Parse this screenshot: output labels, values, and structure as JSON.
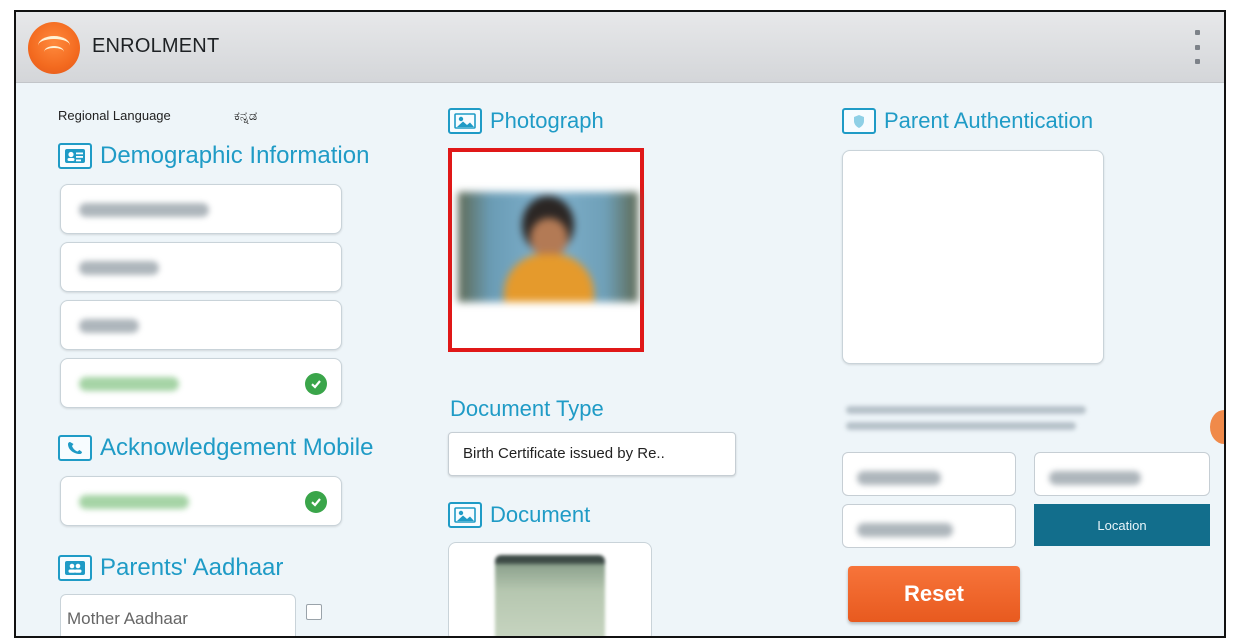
{
  "appbar": {
    "title": "ENROLMENT"
  },
  "regional": {
    "label": "Regional Language",
    "value": "ಕನ್ನಡ"
  },
  "sections": {
    "demographic": "Demographic Information",
    "acknowledgement_mobile": "Acknowledgement Mobile",
    "parents_aadhaar": "Parents' Aadhaar",
    "photograph": "Photograph",
    "document_type": "Document Type",
    "document": "Document",
    "parent_authentication": "Parent Authentication"
  },
  "document_type": {
    "selected": "Birth Certificate issued by Re.."
  },
  "parents": {
    "mother_placeholder": "Mother Aadhaar"
  },
  "buttons": {
    "location": "Location",
    "reset": "Reset"
  },
  "colors": {
    "accent": "#1f9bc6",
    "reset": "#e85a1f",
    "location": "#126e8c",
    "highlight_border": "#e01818",
    "verified": "#3aa54a"
  },
  "icons": [
    "menu-kebab-icon",
    "person-card-icon",
    "phone-icon",
    "parents-icon",
    "image-icon",
    "shield-icon",
    "check-icon"
  ]
}
